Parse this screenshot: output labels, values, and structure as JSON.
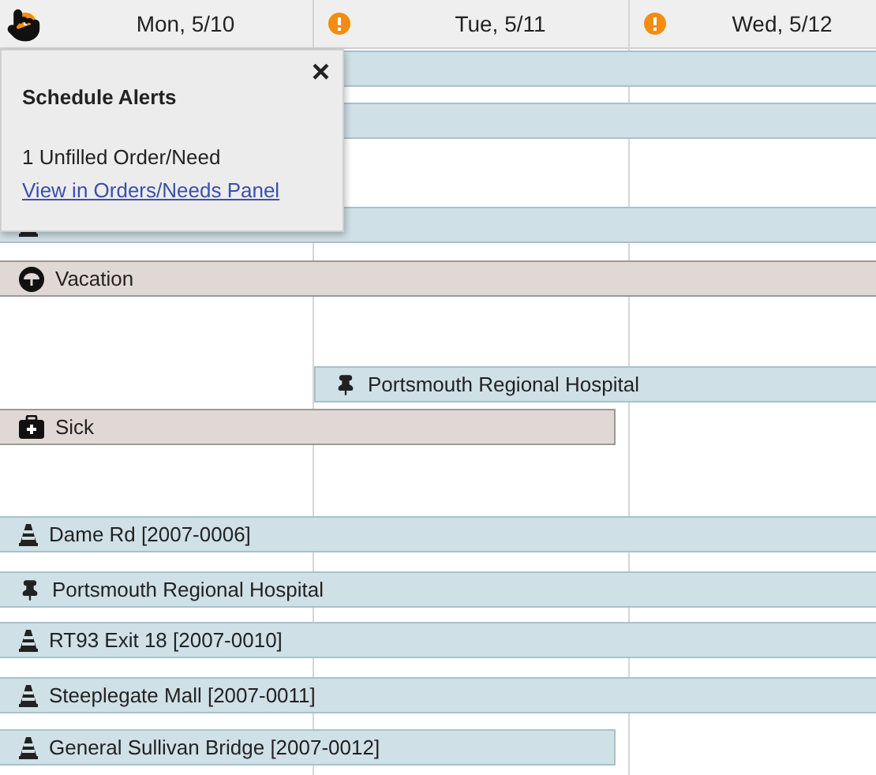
{
  "days": [
    {
      "label": "Mon, 5/10",
      "alert": true,
      "hovered": true
    },
    {
      "label": "Tue, 5/11",
      "alert": true,
      "hovered": false
    },
    {
      "label": "Wed, 5/12",
      "alert": true,
      "hovered": false
    }
  ],
  "bars": [
    {
      "kind": "job"
    },
    {
      "kind": "job"
    },
    {
      "kind": "job"
    },
    {
      "kind": "vacation",
      "label": "Vacation"
    },
    {
      "kind": "location",
      "label": "Portsmouth Regional Hospital"
    },
    {
      "kind": "sick",
      "label": "Sick"
    },
    {
      "kind": "job",
      "label": "Dame Rd [2007-0006]"
    },
    {
      "kind": "location",
      "label": "Portsmouth Regional Hospital"
    },
    {
      "kind": "job",
      "label": "RT93 Exit 18 [2007-0010]"
    },
    {
      "kind": "job",
      "label": "Steeplegate Mall [2007-0011]"
    },
    {
      "kind": "job",
      "label": "General Sullivan Bridge [2007-0012]"
    }
  ],
  "popup": {
    "title": "Schedule Alerts",
    "close": "×",
    "message": "1 Unfilled Order/Need",
    "link": "View in Orders/Needs Panel"
  }
}
